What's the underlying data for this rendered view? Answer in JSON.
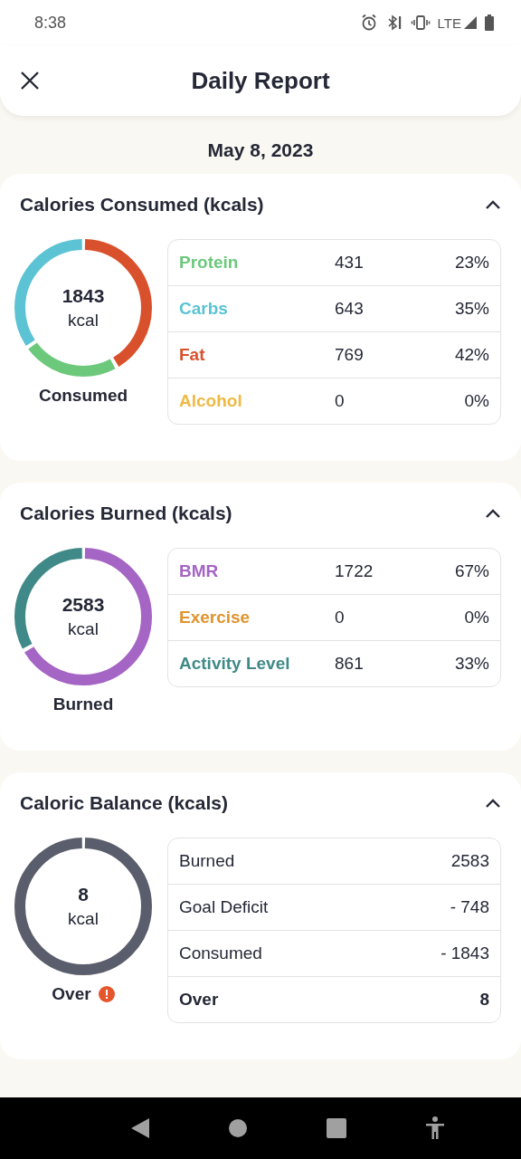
{
  "status_bar": {
    "time": "8:38",
    "network": "LTE"
  },
  "header": {
    "title": "Daily Report"
  },
  "date": "May 8, 2023",
  "cards": [
    {
      "title": "Calories Consumed (kcals)",
      "expanded": true,
      "ring": {
        "value": "1843",
        "unit": "kcal",
        "label": "Consumed",
        "alert": false
      },
      "rows": [
        {
          "label": "Protein",
          "value": "431",
          "percent": "23%",
          "color": "#6cc97c",
          "kind": "macro"
        },
        {
          "label": "Carbs",
          "value": "643",
          "percent": "35%",
          "color": "#5bc3d3",
          "kind": "macro"
        },
        {
          "label": "Fat",
          "value": "769",
          "percent": "42%",
          "color": "#d9512c",
          "kind": "macro"
        },
        {
          "label": "Alcohol",
          "value": "0",
          "percent": "0%",
          "color": "#efb944",
          "kind": "macro"
        }
      ]
    },
    {
      "title": "Calories Burned (kcals)",
      "expanded": true,
      "ring": {
        "value": "2583",
        "unit": "kcal",
        "label": "Burned",
        "alert": false
      },
      "rows": [
        {
          "label": "BMR",
          "value": "1722",
          "percent": "67%",
          "color": "#a465c4",
          "kind": "macro"
        },
        {
          "label": "Exercise",
          "value": "0",
          "percent": "0%",
          "color": "#e0942e",
          "kind": "macro"
        },
        {
          "label": "Activity Level",
          "value": "861",
          "percent": "33%",
          "color": "#3f8a88",
          "kind": "macro"
        }
      ]
    },
    {
      "title": "Caloric Balance (kcals)",
      "expanded": true,
      "ring": {
        "value": "8",
        "unit": "kcal",
        "label": "Over",
        "alert": true,
        "color": "#5a5d6b"
      },
      "rows": [
        {
          "label": "Burned",
          "value": "2583",
          "kind": "line"
        },
        {
          "label": "Goal Deficit",
          "value": "- 748",
          "kind": "line"
        },
        {
          "label": "Consumed",
          "value": "- 1843",
          "kind": "line"
        },
        {
          "label": "Over",
          "value": "8",
          "kind": "total"
        }
      ]
    }
  ]
}
